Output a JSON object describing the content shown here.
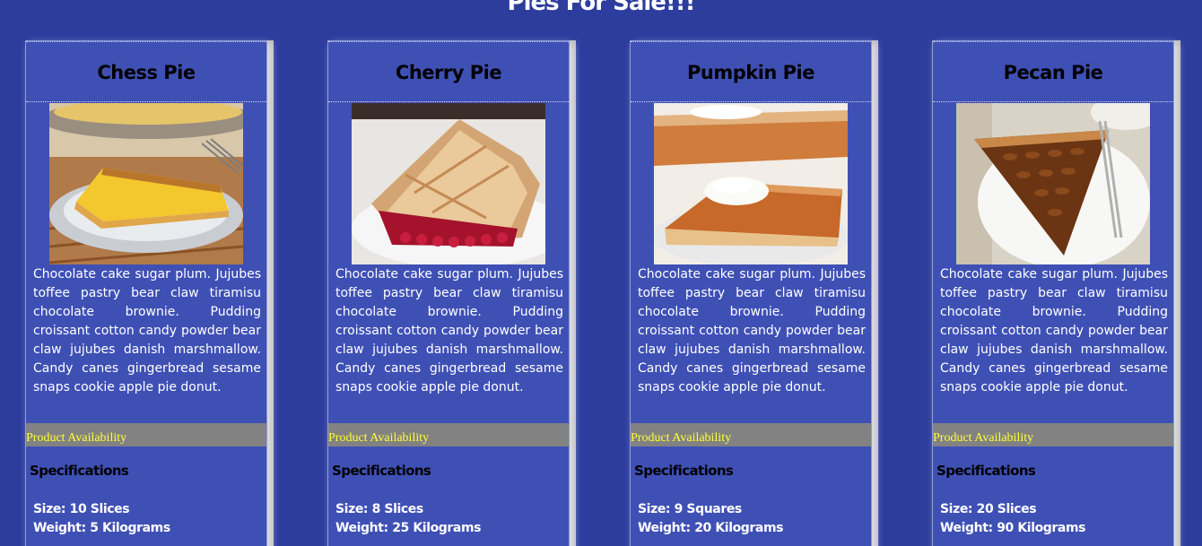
{
  "page": {
    "title": "Pies For Sale!!!"
  },
  "products": [
    {
      "name": "Chess Pie",
      "image_alt": "chess pie slice",
      "description": "Chocolate cake sugar plum. Jujubes toffee pastry bear claw tiramisu chocolate brownie. Pudding croissant cotton candy powder bear claw jujubes danish marshmallow. Candy canes gingerbread sesame snaps cookie apple pie donut.",
      "availability_label": "Product Availability",
      "specs_title": "Specifications",
      "size": "Size: 10 Slices",
      "weight": "Weight: 5 Kilograms"
    },
    {
      "name": "Cherry Pie",
      "image_alt": "cherry pie slice",
      "description": "Chocolate cake sugar plum. Jujubes toffee pastry bear claw tiramisu chocolate brownie. Pudding croissant cotton candy powder bear claw jujubes danish marshmallow. Candy canes gingerbread sesame snaps cookie apple pie donut.",
      "availability_label": "Product Availability",
      "specs_title": "Specifications",
      "size": "Size: 8 Slices",
      "weight": "Weight: 25 Kilograms"
    },
    {
      "name": "Pumpkin Pie",
      "image_alt": "pumpkin pie slice",
      "description": "Chocolate cake sugar plum. Jujubes toffee pastry bear claw tiramisu chocolate brownie. Pudding croissant cotton candy powder bear claw jujubes danish marshmallow. Candy canes gingerbread sesame snaps cookie apple pie donut.",
      "availability_label": "Product Availability",
      "specs_title": "Specifications",
      "size": "Size: 9 Squares",
      "weight": "Weight: 20 Kilograms"
    },
    {
      "name": "Pecan Pie",
      "image_alt": "pecan pie slice",
      "description": "Chocolate cake sugar plum. Jujubes toffee pastry bear claw tiramisu chocolate brownie. Pudding croissant cotton candy powder bear claw jujubes danish marshmallow. Candy canes gingerbread sesame snaps cookie apple pie donut.",
      "availability_label": "Product Availability",
      "specs_title": "Specifications",
      "size": "Size: 20 Slices",
      "weight": "Weight: 90 Kilograms"
    }
  ],
  "colors": {
    "page_background": "#2d3d9e",
    "card_background": "#3f50b5",
    "availability_bar": "#828282",
    "availability_text": "#ffff33"
  }
}
